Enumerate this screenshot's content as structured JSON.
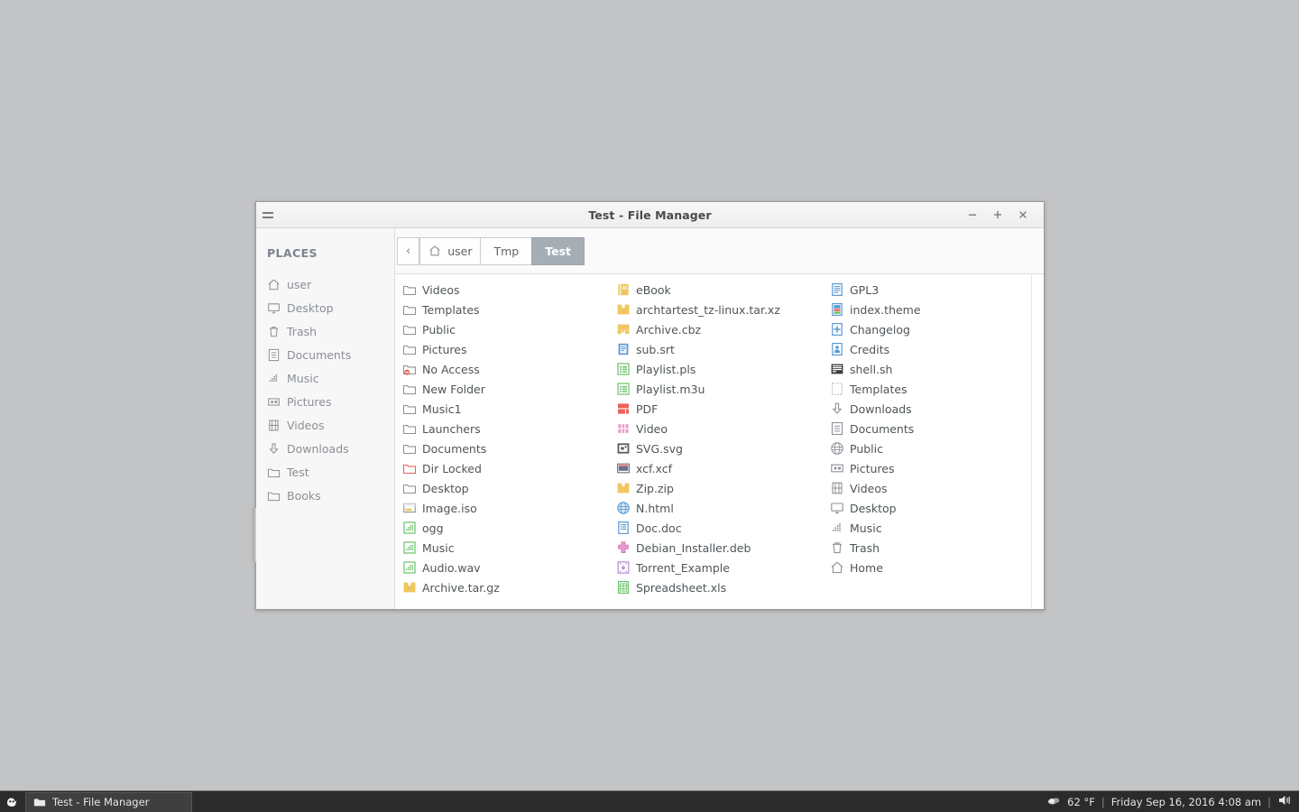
{
  "desktop": {
    "background": "#c3c4c6"
  },
  "window": {
    "title": "Test - File Manager",
    "menu_icon": "hamburger-icon",
    "controls": {
      "minimize": "–",
      "maximize": "+",
      "close": "×"
    }
  },
  "sidebar": {
    "heading": "PLACES",
    "items": [
      {
        "label": "user",
        "icon": "home-icon"
      },
      {
        "label": "Desktop",
        "icon": "desktop-icon"
      },
      {
        "label": "Trash",
        "icon": "trash-icon"
      },
      {
        "label": "Documents",
        "icon": "document-icon"
      },
      {
        "label": "Music",
        "icon": "music-icon"
      },
      {
        "label": "Pictures",
        "icon": "picture-icon"
      },
      {
        "label": "Videos",
        "icon": "video-icon"
      },
      {
        "label": "Downloads",
        "icon": "download-icon"
      },
      {
        "label": "Test",
        "icon": "folder-icon"
      },
      {
        "label": "Books",
        "icon": "folder-icon"
      }
    ]
  },
  "pathbar": {
    "back_label": "‹",
    "crumbs": [
      {
        "label": "user",
        "icon": "home-icon",
        "active": false
      },
      {
        "label": "Tmp",
        "icon": "",
        "active": false
      },
      {
        "label": "Test",
        "icon": "",
        "active": true
      }
    ],
    "active_color": "#a6aeb5"
  },
  "files": {
    "columns": [
      [
        {
          "label": "Videos",
          "icon": "folder-icon"
        },
        {
          "label": "Templates",
          "icon": "folder-icon"
        },
        {
          "label": "Public",
          "icon": "folder-icon"
        },
        {
          "label": "Pictures",
          "icon": "folder-icon"
        },
        {
          "label": "No Access",
          "icon": "folder-locked-icon"
        },
        {
          "label": "New Folder",
          "icon": "folder-icon"
        },
        {
          "label": "Music1",
          "icon": "folder-icon"
        },
        {
          "label": "Launchers",
          "icon": "folder-icon"
        },
        {
          "label": "Documents",
          "icon": "folder-icon"
        },
        {
          "label": "Dir Locked",
          "icon": "folder-red-icon"
        },
        {
          "label": "Desktop",
          "icon": "folder-icon"
        },
        {
          "label": "Image.iso",
          "icon": "iso-image-icon"
        },
        {
          "label": "ogg",
          "icon": "audio-green-icon"
        },
        {
          "label": "Music",
          "icon": "audio-green-icon"
        },
        {
          "label": "Audio.wav",
          "icon": "audio-green-icon"
        },
        {
          "label": "Archive.tar.gz",
          "icon": "archive-yellow-icon"
        }
      ],
      [
        {
          "label": "eBook",
          "icon": "ebook-icon"
        },
        {
          "label": "archtartest_tz-linux.tar.xz",
          "icon": "archive-yellow-icon"
        },
        {
          "label": "Archive.cbz",
          "icon": "archive-cbz-icon"
        },
        {
          "label": "sub.srt",
          "icon": "subtitle-blue-icon"
        },
        {
          "label": "Playlist.pls",
          "icon": "playlist-green-icon"
        },
        {
          "label": "Playlist.m3u",
          "icon": "playlist-green-icon"
        },
        {
          "label": "PDF",
          "icon": "pdf-red-icon"
        },
        {
          "label": "Video",
          "icon": "video-pink-icon"
        },
        {
          "label": "SVG.svg",
          "icon": "svg-icon"
        },
        {
          "label": "xcf.xcf",
          "icon": "xcf-icon"
        },
        {
          "label": "Zip.zip",
          "icon": "archive-yellow-icon"
        },
        {
          "label": "N.html",
          "icon": "html-globe-icon"
        },
        {
          "label": "Doc.doc",
          "icon": "doc-blue-icon"
        },
        {
          "label": "Debian_Installer.deb",
          "icon": "deb-pink-icon"
        },
        {
          "label": "Torrent_Example",
          "icon": "torrent-purple-icon"
        },
        {
          "label": "Spreadsheet.xls",
          "icon": "spreadsheet-green-icon"
        }
      ],
      [
        {
          "label": "GPL3",
          "icon": "text-blue-icon"
        },
        {
          "label": "index.theme",
          "icon": "theme-icon"
        },
        {
          "label": "Changelog",
          "icon": "plus-blue-icon"
        },
        {
          "label": "Credits",
          "icon": "credits-icon"
        },
        {
          "label": "shell.sh",
          "icon": "shell-icon"
        },
        {
          "label": "Templates",
          "icon": "templates-dotted-icon"
        },
        {
          "label": "Downloads",
          "icon": "download-icon"
        },
        {
          "label": "Documents",
          "icon": "document-icon"
        },
        {
          "label": "Public",
          "icon": "globe-icon"
        },
        {
          "label": "Pictures",
          "icon": "picture-icon"
        },
        {
          "label": "Videos",
          "icon": "video-icon"
        },
        {
          "label": "Desktop",
          "icon": "desktop-icon"
        },
        {
          "label": "Music",
          "icon": "music-icon"
        },
        {
          "label": "Trash",
          "icon": "trash-icon"
        },
        {
          "label": "Home",
          "icon": "home-icon"
        }
      ]
    ]
  },
  "taskbar": {
    "menu_icon": "xfce-mouse-icon",
    "task_label": "Test - File Manager",
    "task_icon": "folder-icon",
    "weather_icon": "cloud-icon",
    "temperature": "62 °F",
    "separator1": "|",
    "datetime": "Friday Sep 16, 2016  4:08 am",
    "separator2": "|",
    "volume_icon": "speaker-icon"
  }
}
